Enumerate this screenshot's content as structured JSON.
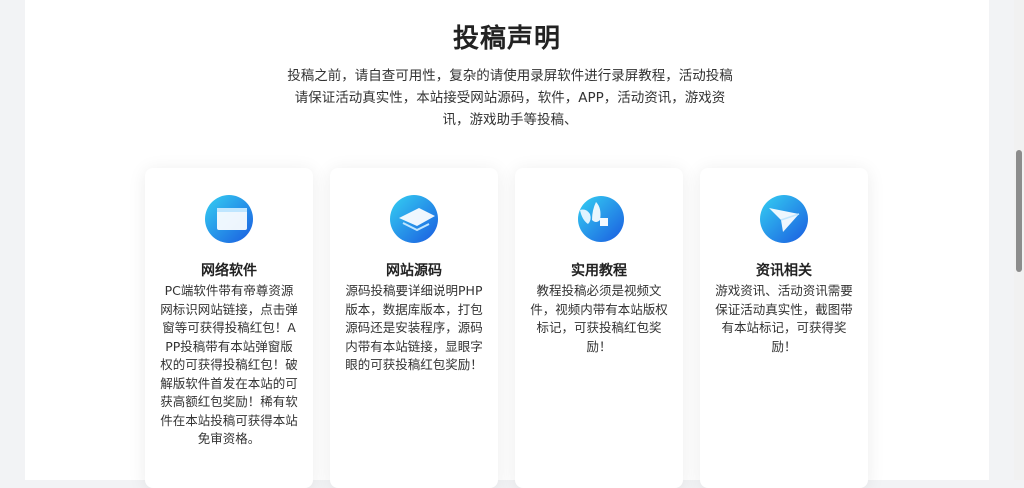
{
  "section": {
    "title": "投稿声明",
    "intro": "投稿之前，请自查可用性，复杂的请使用录屏软件进行录屏教程，活动投稿请保证活动真实性，本站接受网站源码，软件，APP，活动资讯，游戏资讯，游戏助手等投稿、"
  },
  "cards": [
    {
      "title": "网络软件",
      "icon": "window-icon",
      "desc": "PC端软件带有帝尊资源网标识网站链接，点击弹窗等可获得投稿红包！APP投稿带有本站弹窗版权的可获得投稿红包！破解版软件首发在本站的可获高额红包奖励！稀有软件在本站投稿可获得本站免审资格。"
    },
    {
      "title": "网站源码",
      "icon": "layers-icon",
      "desc": "源码投稿要详细说明PHP版本，数据库版本，打包源码还是安装程序，源码内带有本站链接，显眼字眼的可获投稿红包奖励！"
    },
    {
      "title": "实用教程",
      "icon": "book-icon",
      "desc": "教程投稿必须是视频文件，视频内带有本站版权标记，可获投稿红包奖励！"
    },
    {
      "title": "资讯相关",
      "icon": "paper-plane-icon",
      "desc": "游戏资讯、活动资讯需要保证活动真实性，截图带有本站标记，可获得奖励！"
    }
  ],
  "colors": {
    "icon_gradient_start": "#2ec7f0",
    "icon_gradient_end": "#1a5fe0",
    "title_text": "#222222",
    "body_text": "#333333"
  }
}
